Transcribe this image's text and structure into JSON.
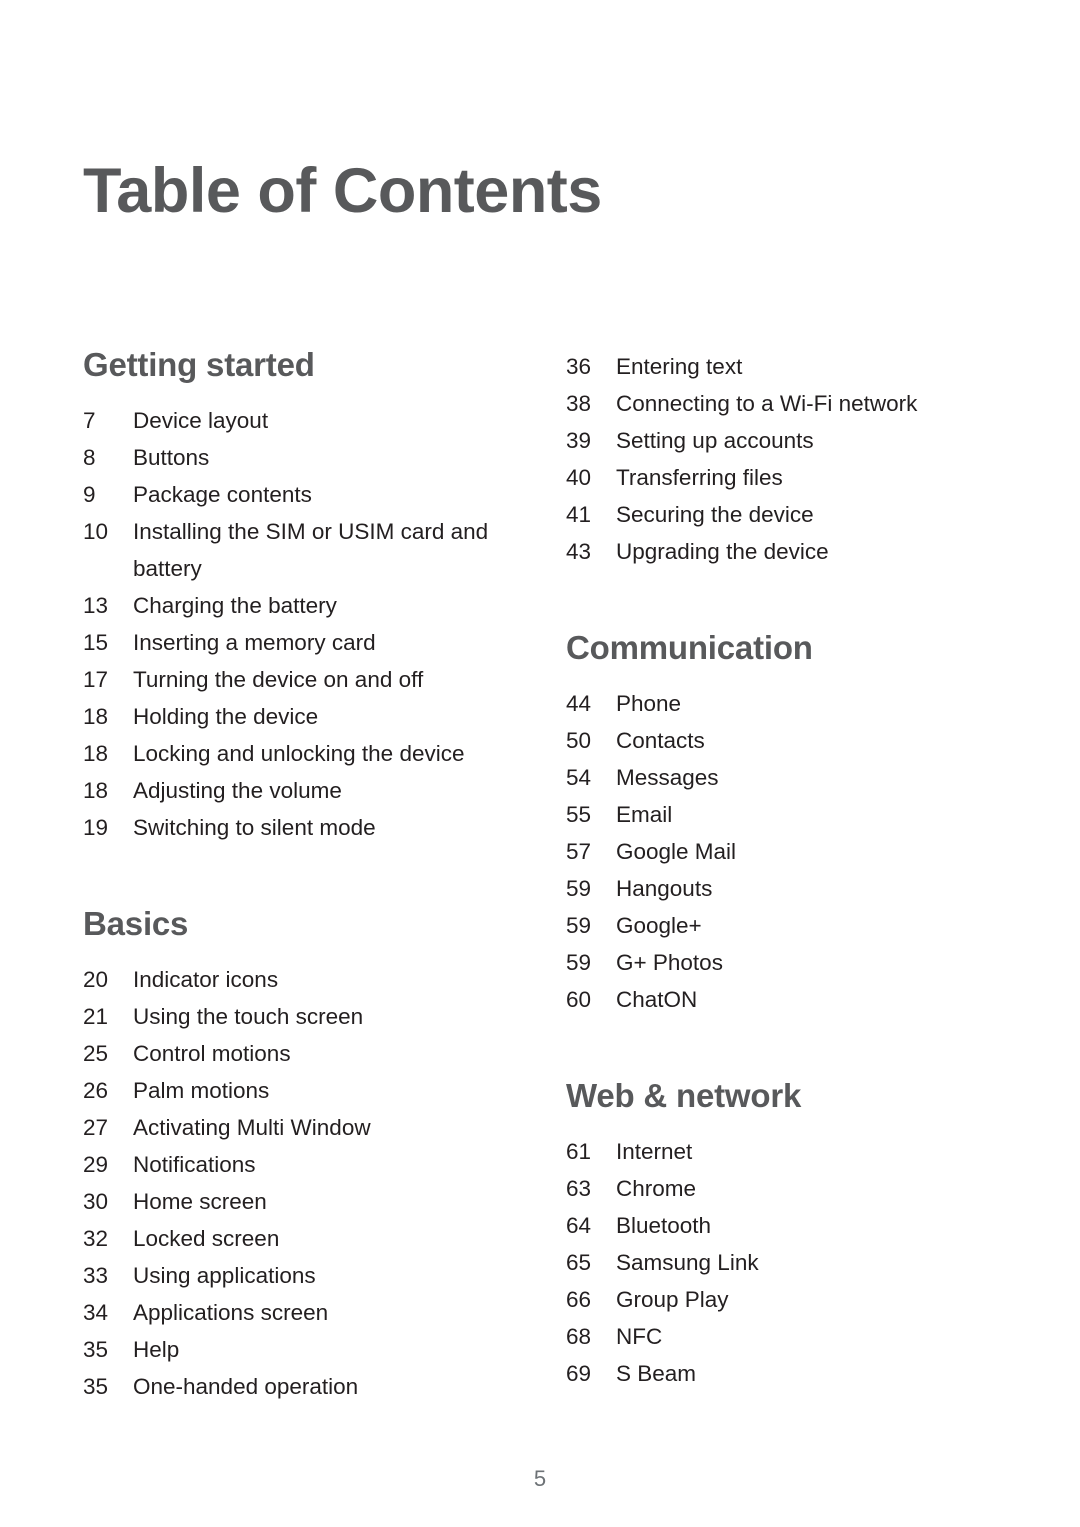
{
  "document": {
    "title": "Table of Contents",
    "folio": "5"
  },
  "colors": {
    "heading": "#58595B",
    "body_text": "#231F20",
    "folio": "#6D7276",
    "background": "#FFFFFF"
  },
  "columns": [
    {
      "name": "left-column",
      "sections": [
        {
          "heading": "Getting started",
          "entries": [
            {
              "page": "7",
              "title": "Device layout"
            },
            {
              "page": "8",
              "title": "Buttons"
            },
            {
              "page": "9",
              "title": "Package contents"
            },
            {
              "page": "10",
              "title": "Installing the SIM or USIM card and battery"
            },
            {
              "page": "13",
              "title": "Charging the battery"
            },
            {
              "page": "15",
              "title": "Inserting a memory card"
            },
            {
              "page": "17",
              "title": "Turning the device on and off"
            },
            {
              "page": "18",
              "title": "Holding the device"
            },
            {
              "page": "18",
              "title": "Locking and unlocking the device"
            },
            {
              "page": "18",
              "title": "Adjusting the volume"
            },
            {
              "page": "19",
              "title": "Switching to silent mode"
            }
          ]
        },
        {
          "heading": "Basics",
          "entries": [
            {
              "page": "20",
              "title": "Indicator icons"
            },
            {
              "page": "21",
              "title": "Using the touch screen"
            },
            {
              "page": "25",
              "title": "Control motions"
            },
            {
              "page": "26",
              "title": "Palm motions"
            },
            {
              "page": "27",
              "title": "Activating Multi Window"
            },
            {
              "page": "29",
              "title": "Notifications"
            },
            {
              "page": "30",
              "title": "Home screen"
            },
            {
              "page": "32",
              "title": "Locked screen"
            },
            {
              "page": "33",
              "title": "Using applications"
            },
            {
              "page": "34",
              "title": "Applications screen"
            },
            {
              "page": "35",
              "title": "Help"
            },
            {
              "page": "35",
              "title": "One-handed operation"
            }
          ]
        }
      ]
    },
    {
      "name": "right-column",
      "sections": [
        {
          "heading": "",
          "entries": [
            {
              "page": "36",
              "title": "Entering text"
            },
            {
              "page": "38",
              "title": "Connecting to a Wi-Fi network"
            },
            {
              "page": "39",
              "title": "Setting up accounts"
            },
            {
              "page": "40",
              "title": "Transferring files"
            },
            {
              "page": "41",
              "title": "Securing the device"
            },
            {
              "page": "43",
              "title": "Upgrading the device"
            }
          ]
        },
        {
          "heading": "Communication",
          "entries": [
            {
              "page": "44",
              "title": "Phone"
            },
            {
              "page": "50",
              "title": "Contacts"
            },
            {
              "page": "54",
              "title": "Messages"
            },
            {
              "page": "55",
              "title": "Email"
            },
            {
              "page": "57",
              "title": "Google Mail"
            },
            {
              "page": "59",
              "title": "Hangouts"
            },
            {
              "page": "59",
              "title": "Google+"
            },
            {
              "page": "59",
              "title": "G+ Photos"
            },
            {
              "page": "60",
              "title": "ChatON"
            }
          ]
        },
        {
          "heading": "Web & network",
          "entries": [
            {
              "page": "61",
              "title": "Internet"
            },
            {
              "page": "63",
              "title": "Chrome"
            },
            {
              "page": "64",
              "title": "Bluetooth"
            },
            {
              "page": "65",
              "title": "Samsung Link"
            },
            {
              "page": "66",
              "title": "Group Play"
            },
            {
              "page": "68",
              "title": "NFC"
            },
            {
              "page": "69",
              "title": "S Beam"
            }
          ]
        }
      ]
    }
  ]
}
